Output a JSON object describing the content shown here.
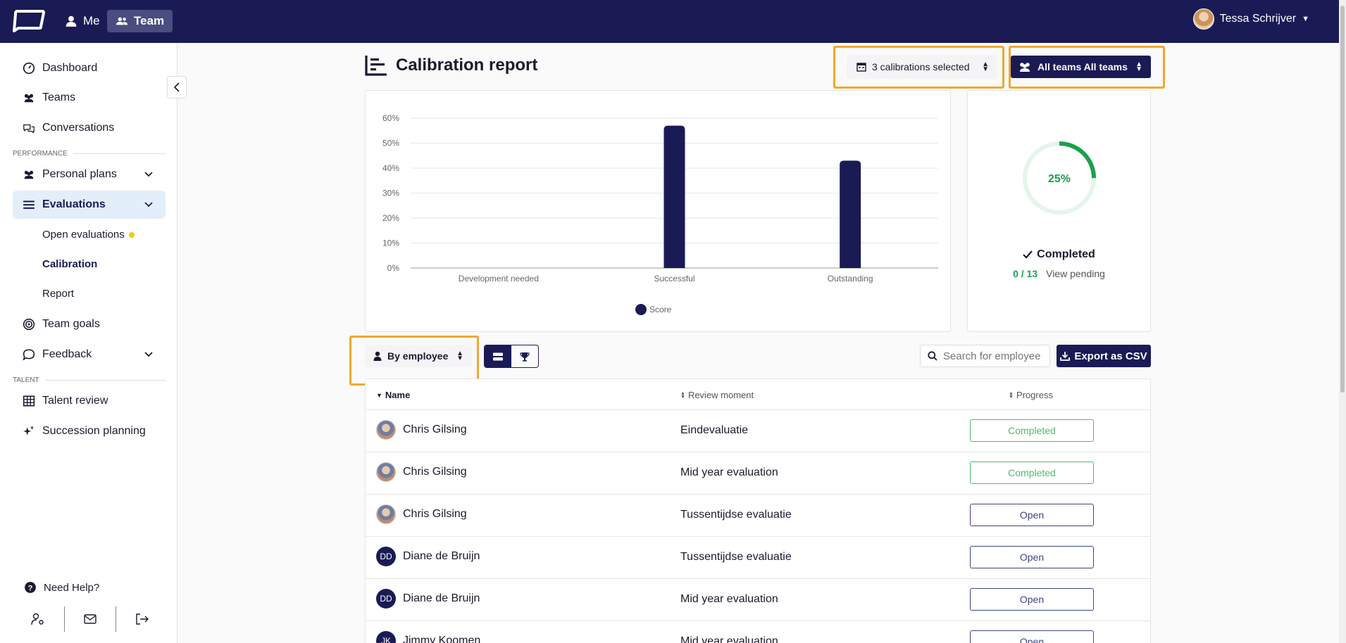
{
  "topbar": {
    "nav": [
      {
        "label": "Me",
        "icon": "user-icon"
      },
      {
        "label": "Team",
        "icon": "users-icon",
        "active": true
      }
    ],
    "user_name": "Tessa Schrijver"
  },
  "sidebar": {
    "items": [
      {
        "label": "Dashboard",
        "icon": "dashboard-icon"
      },
      {
        "label": "Teams",
        "icon": "users-icon"
      },
      {
        "label": "Conversations",
        "icon": "chat-icon"
      }
    ],
    "section_performance": "PERFORMANCE",
    "performance": [
      {
        "label": "Personal plans",
        "icon": "users-icon"
      },
      {
        "label": "Evaluations",
        "icon": "list-icon",
        "active": true
      }
    ],
    "evaluations_sub": [
      {
        "label": "Open evaluations"
      },
      {
        "label": "Calibration",
        "active": true
      },
      {
        "label": "Report"
      }
    ],
    "more": [
      {
        "label": "Team goals",
        "icon": "target-icon"
      },
      {
        "label": "Feedback",
        "icon": "message-icon"
      }
    ],
    "section_talent": "TALENT",
    "talent": [
      {
        "label": "Talent review",
        "icon": "grid-icon"
      },
      {
        "label": "Succession planning",
        "icon": "sparkle-icon"
      }
    ],
    "help": "Need Help?"
  },
  "header": {
    "title": "Calibration report",
    "calibrations_select": "3 calibrations selected",
    "teams_select": "All teams All teams"
  },
  "chart_data": {
    "type": "bar",
    "categories": [
      "Development needed",
      "Successful",
      "Outstanding"
    ],
    "series": [
      {
        "name": "Score",
        "values": [
          0,
          57,
          43
        ]
      }
    ],
    "y_ticks": [
      "0%",
      "10%",
      "20%",
      "30%",
      "40%",
      "50%",
      "60%"
    ],
    "ylim": [
      0,
      60
    ],
    "grid": true,
    "legend": "bottom",
    "bar_color": "#1a1b55"
  },
  "progress": {
    "percent_label": "25%",
    "percent": 25,
    "status": "Completed",
    "count": "0 / 13",
    "view_pending": "View pending"
  },
  "toolbar": {
    "group_by": "By employee",
    "search_placeholder": "Search for employee",
    "export_label": "Export as CSV"
  },
  "table": {
    "headers": [
      "Name",
      "Review moment",
      "Progress"
    ],
    "rows": [
      {
        "name": "Chris Gilsing",
        "review": "Eindevaluatie",
        "progress": "Completed",
        "avatar": "photo"
      },
      {
        "name": "Chris Gilsing",
        "review": "Mid year evaluation",
        "progress": "Completed",
        "avatar": "photo"
      },
      {
        "name": "Chris Gilsing",
        "review": "Tussentijdse evaluatie",
        "progress": "Open",
        "avatar": "photo"
      },
      {
        "name": "Diane de Bruijn",
        "review": "Tussentijdse evaluatie",
        "progress": "Open",
        "avatar": "DD"
      },
      {
        "name": "Diane de Bruijn",
        "review": "Mid year evaluation",
        "progress": "Open",
        "avatar": "DD"
      },
      {
        "name": "Jimmy Koomen",
        "review": "Mid year evaluation",
        "progress": "Open",
        "avatar": "JK"
      }
    ]
  }
}
